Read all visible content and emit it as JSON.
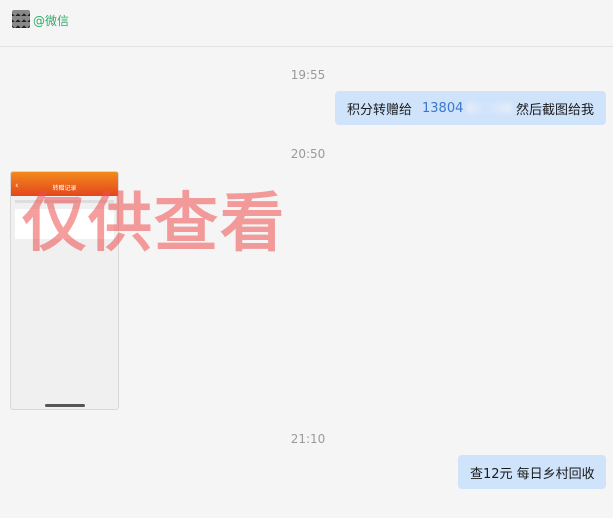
{
  "header": {
    "wechat_tag": "@微信"
  },
  "messages": [
    {
      "time": "19:55",
      "text": "积分转赠给",
      "phone": "13804",
      "suffix": "然后截图给我"
    },
    {
      "time": "20:50",
      "image_title": "转赠记录",
      "watermark": "仅供查看"
    },
    {
      "time": "21:10",
      "text": "查12元  每日乡村回收"
    }
  ]
}
